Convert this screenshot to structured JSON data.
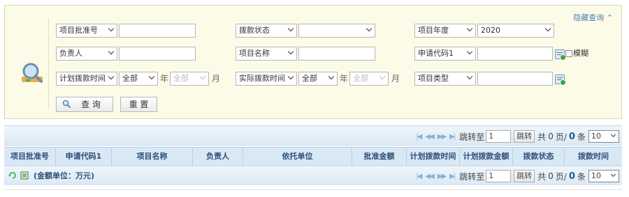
{
  "search": {
    "hide_link": "隐藏查询 ⌃",
    "row1": {
      "f1_select": "项目批准号",
      "f1_value": "",
      "f2_select": "拨款状态",
      "f2_value": "",
      "f3_select": "项目年度",
      "f3_value": "2020"
    },
    "row2": {
      "f1_select": "负责人",
      "f1_value": "",
      "f2_select": "项目名称",
      "f2_value": "",
      "f3_select": "申请代码1",
      "f3_value": "",
      "fuzzy_label": "模糊"
    },
    "row3": {
      "f1_select": "计划拨款时间",
      "f1_scope": "全部",
      "f1_year_unit": "年",
      "f1_month": "全部",
      "f1_month_unit": "月",
      "f2_select": "实际拨款时间",
      "f2_scope": "全部",
      "f2_year_unit": "年",
      "f2_month": "全部",
      "f2_month_unit": "月",
      "f3_select": "项目类型",
      "f3_value": ""
    },
    "query_label": "查 询",
    "reset_label": "重 置"
  },
  "pager": {
    "first": "|◀",
    "prev": "◀◀",
    "next": "▶▶",
    "last": "▶|",
    "goto_label": "跳转至",
    "goto_value": "1",
    "goto_button": "跳转",
    "total_prefix": "共",
    "total_pages": "0",
    "pages_suffix": "页/",
    "total_records": "0",
    "records_suffix": "条",
    "page_size": "10"
  },
  "table": {
    "columns": [
      "项目批准号",
      "申请代码1",
      "项目名称",
      "负责人",
      "依托单位",
      "批准金额",
      "计划拨款时间",
      "计划拨款金额",
      "拨款状态",
      "拨款时间"
    ]
  },
  "footer": {
    "unit_note": "(金额单位：万元)"
  }
}
